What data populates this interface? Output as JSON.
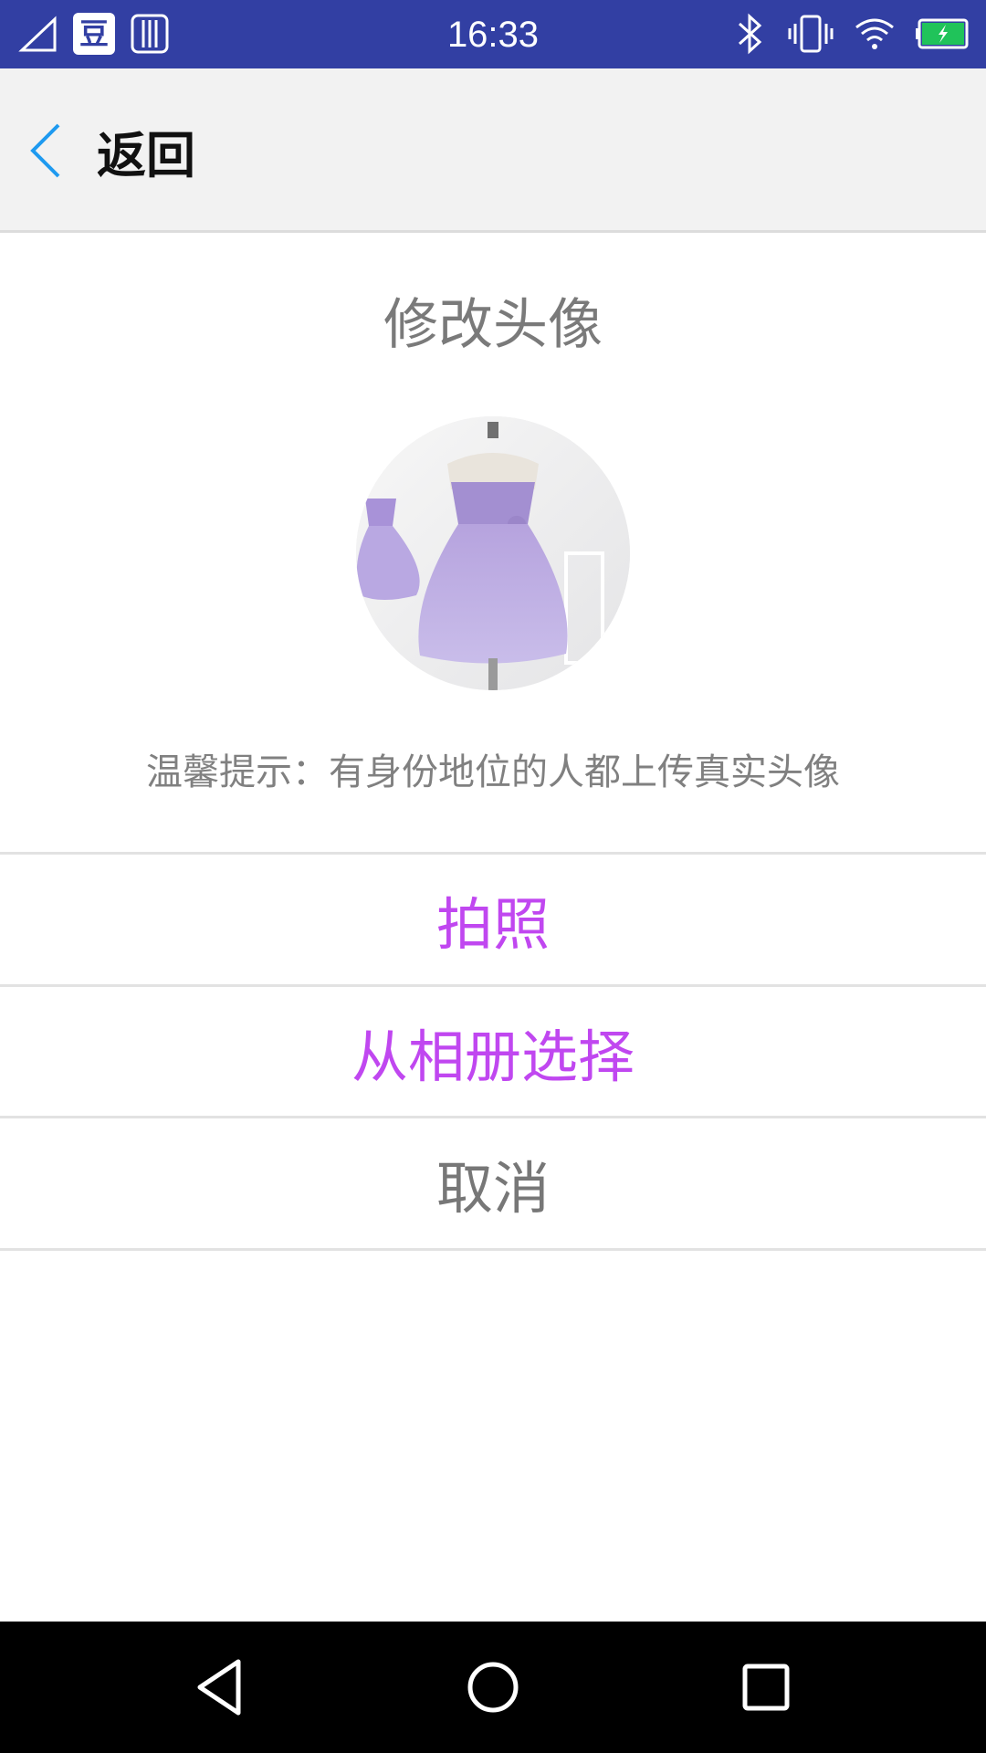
{
  "status_bar": {
    "time": "16:33",
    "app_badge": "豆",
    "icons": [
      "signal-icon",
      "app-notification-icon",
      "sim-icon",
      "bluetooth-icon",
      "vibrate-icon",
      "wifi-icon",
      "battery-charging-icon"
    ]
  },
  "header": {
    "back_label": "返回"
  },
  "main": {
    "title": "修改头像",
    "avatar_description_icon": "avatar-image",
    "tip": "温馨提示：有身份地位的人都上传真实头像"
  },
  "actions": {
    "take_photo": "拍照",
    "choose_album": "从相册选择",
    "cancel": "取消"
  },
  "colors": {
    "status_bar": "#323fa3",
    "accent_purple": "#c047f0",
    "back_arrow": "#1e9af0"
  },
  "nav_bar": {
    "icons": [
      "back-nav-icon",
      "home-nav-icon",
      "recents-nav-icon"
    ]
  }
}
